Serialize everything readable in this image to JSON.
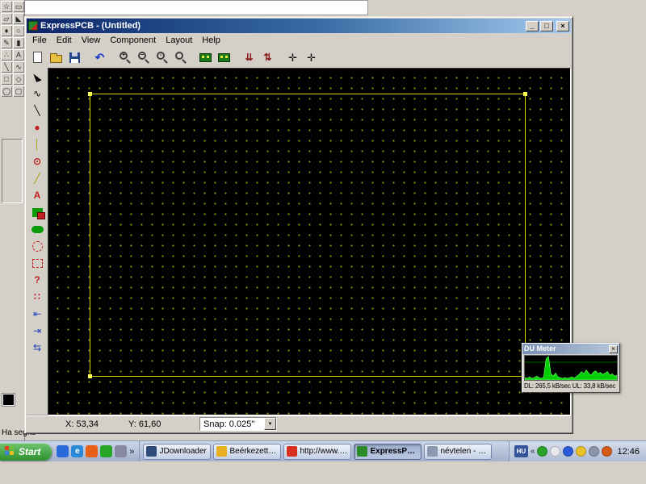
{
  "colors": {
    "titlebar_start": "#0a246a",
    "titlebar_end": "#a6caf0",
    "window_chrome": "#d4d0c8",
    "canvas_bg": "#000000",
    "grid_dot": "#8f8f00",
    "board_outline": "#d8d800",
    "du_graph_green": "#00cc00",
    "start_button_green": "#2f8f2f"
  },
  "paint": {
    "status_text": "Ha segíts",
    "foreground_color": "#000000",
    "tools": [
      {
        "name": "free-select",
        "glyph": "☆"
      },
      {
        "name": "select",
        "glyph": "▭"
      },
      {
        "name": "eraser",
        "glyph": "▱"
      },
      {
        "name": "fill",
        "glyph": "◣"
      },
      {
        "name": "color-picker",
        "glyph": "♦"
      },
      {
        "name": "magnifier",
        "glyph": "○"
      },
      {
        "name": "pencil",
        "glyph": "✎"
      },
      {
        "name": "brush",
        "glyph": "▮"
      },
      {
        "name": "airbrush",
        "glyph": "∴"
      },
      {
        "name": "text",
        "glyph": "A"
      },
      {
        "name": "line",
        "glyph": "╲"
      },
      {
        "name": "curve",
        "glyph": "∿"
      },
      {
        "name": "rectangle",
        "glyph": "□"
      },
      {
        "name": "polygon",
        "glyph": "◇"
      },
      {
        "name": "ellipse",
        "glyph": "◯"
      },
      {
        "name": "rounded-rectangle",
        "glyph": "▢"
      }
    ]
  },
  "express": {
    "title": "ExpressPCB - (Untitled)",
    "window_buttons": {
      "minimize": "_",
      "maximize": "□",
      "close": "×"
    },
    "menus": [
      "File",
      "Edit",
      "View",
      "Component",
      "Layout",
      "Help"
    ],
    "toolbar": [
      {
        "name": "new-file",
        "glyph": ""
      },
      {
        "name": "open-file",
        "glyph": ""
      },
      {
        "name": "save-file",
        "glyph": ""
      },
      {
        "name": "undo",
        "glyph": "↶"
      },
      {
        "name": "zoom-in",
        "glyph": "+"
      },
      {
        "name": "zoom-out",
        "glyph": "−"
      },
      {
        "name": "zoom-board",
        "glyph": "▫"
      },
      {
        "name": "zoom-previous",
        "glyph": ""
      },
      {
        "name": "view-board-top",
        "glyph": ""
      },
      {
        "name": "view-board-bottom",
        "glyph": ""
      },
      {
        "name": "spacing-tool-1",
        "glyph": "⇊"
      },
      {
        "name": "spacing-tool-2",
        "glyph": "⇅"
      },
      {
        "name": "pan-tool-1",
        "glyph": "✛"
      },
      {
        "name": "pan-tool-2",
        "glyph": "✛"
      }
    ],
    "side_tools": [
      {
        "name": "select-tool",
        "glyph": ""
      },
      {
        "name": "curve-tool",
        "glyph": "∿"
      },
      {
        "name": "line-tool",
        "glyph": "╲"
      },
      {
        "name": "pad-tool",
        "glyph": "●"
      },
      {
        "name": "trace-tool",
        "glyph": "│"
      },
      {
        "name": "via-tool",
        "glyph": "⊙"
      },
      {
        "name": "angle-trace-tool",
        "glyph": "╱"
      },
      {
        "name": "text-tool",
        "glyph": "A"
      },
      {
        "name": "plane-tool",
        "glyph": ""
      },
      {
        "name": "filled-ellipse-tool",
        "glyph": ""
      },
      {
        "name": "keepout-circle-tool",
        "glyph": ""
      },
      {
        "name": "keepout-rect-tool",
        "glyph": ""
      },
      {
        "name": "component-help-tool",
        "glyph": "?"
      },
      {
        "name": "grid-dots-tool",
        "glyph": "∷"
      },
      {
        "name": "disconnect-left-tool",
        "glyph": "⇤"
      },
      {
        "name": "disconnect-right-tool",
        "glyph": "⇥"
      },
      {
        "name": "swap-traces-tool",
        "glyph": "⇆"
      }
    ],
    "status": {
      "x": "X: 53,34",
      "y": "Y: 61,60",
      "snap": "Snap:  0.025\"",
      "dropdown_arrow": "▼"
    }
  },
  "du_meter": {
    "title": "DU Meter",
    "close": "×",
    "stats": "DL: 265,5 kB/sec  UL: 33,8 kB/sec",
    "graph_color": "#00cc00",
    "graph_line_color": "#55ff55",
    "graph_values": [
      3,
      2,
      4,
      2,
      3,
      5,
      3,
      2,
      4,
      28,
      31,
      8,
      5,
      9,
      4,
      3,
      2,
      3,
      2,
      3,
      4,
      2,
      5,
      7,
      11,
      8,
      13,
      9,
      6,
      10,
      12,
      8,
      10,
      7,
      9,
      11,
      6,
      8,
      5,
      6
    ]
  },
  "taskbar": {
    "start_label": "Start",
    "quick_launch": [
      {
        "name": "quick-launch-icon-1",
        "glyph": "",
        "color": "#2a6ad8"
      },
      {
        "name": "quick-launch-icon-2",
        "glyph": "e",
        "color": "#2a8ad8"
      },
      {
        "name": "quick-launch-icon-3",
        "glyph": "",
        "color": "#e86018"
      },
      {
        "name": "quick-launch-icon-4",
        "glyph": "",
        "color": "#28a428"
      },
      {
        "name": "quick-launch-icon-5",
        "glyph": "",
        "color": "#8888a0"
      }
    ],
    "overflow_chevron": "»",
    "tasks": [
      {
        "label": "JDownloader",
        "icon_color": "#304a7a",
        "active": false
      },
      {
        "label": "Beérkezett üze...",
        "icon_color": "#e8b020",
        "active": false
      },
      {
        "label": "http://www.ke...",
        "icon_color": "#d83020",
        "active": false
      },
      {
        "label": "ExpressPCB - ...",
        "icon_color": "#2a8a2a",
        "active": true
      },
      {
        "label": "névtelen - Paint",
        "icon_color": "#8a98b0",
        "active": false
      }
    ],
    "tray": {
      "lang": "HU",
      "chevron": "«",
      "icons": [
        {
          "name": "tray-icon-1",
          "color": "#28a428"
        },
        {
          "name": "tray-icon-2",
          "color": "#e8e8f0"
        },
        {
          "name": "tray-icon-3",
          "color": "#2a5ad8"
        },
        {
          "name": "tray-icon-4",
          "color": "#e8c028"
        },
        {
          "name": "tray-icon-5",
          "color": "#8a94a8"
        },
        {
          "name": "tray-icon-6",
          "color": "#d85a18"
        }
      ],
      "clock": "12:46"
    }
  }
}
